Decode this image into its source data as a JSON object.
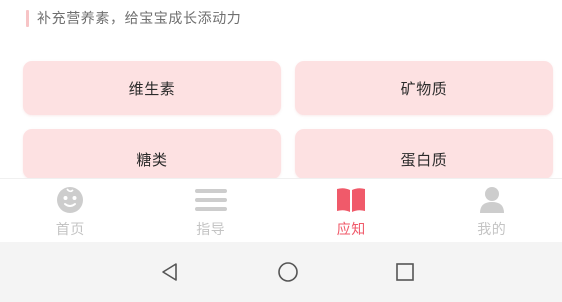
{
  "header": {
    "text": "补充营养素，给宝宝成长添动力"
  },
  "categories": [
    {
      "label": "维生素"
    },
    {
      "label": "矿物质"
    },
    {
      "label": "糖类"
    },
    {
      "label": "蛋白质"
    }
  ],
  "tabbar": {
    "tabs": [
      {
        "label": "首页",
        "icon": "baby-face-icon",
        "active": false
      },
      {
        "label": "指导",
        "icon": "menu-lines-icon",
        "active": false
      },
      {
        "label": "应知",
        "icon": "book-icon",
        "active": true
      },
      {
        "label": "我的",
        "icon": "person-icon",
        "active": false
      }
    ]
  },
  "navbar": {
    "buttons": [
      "back-icon",
      "home-icon",
      "recent-apps-icon"
    ]
  },
  "colors": {
    "accent": "#f05a6a",
    "card_bg": "#fde1e2",
    "inactive": "#c4c4c4"
  }
}
